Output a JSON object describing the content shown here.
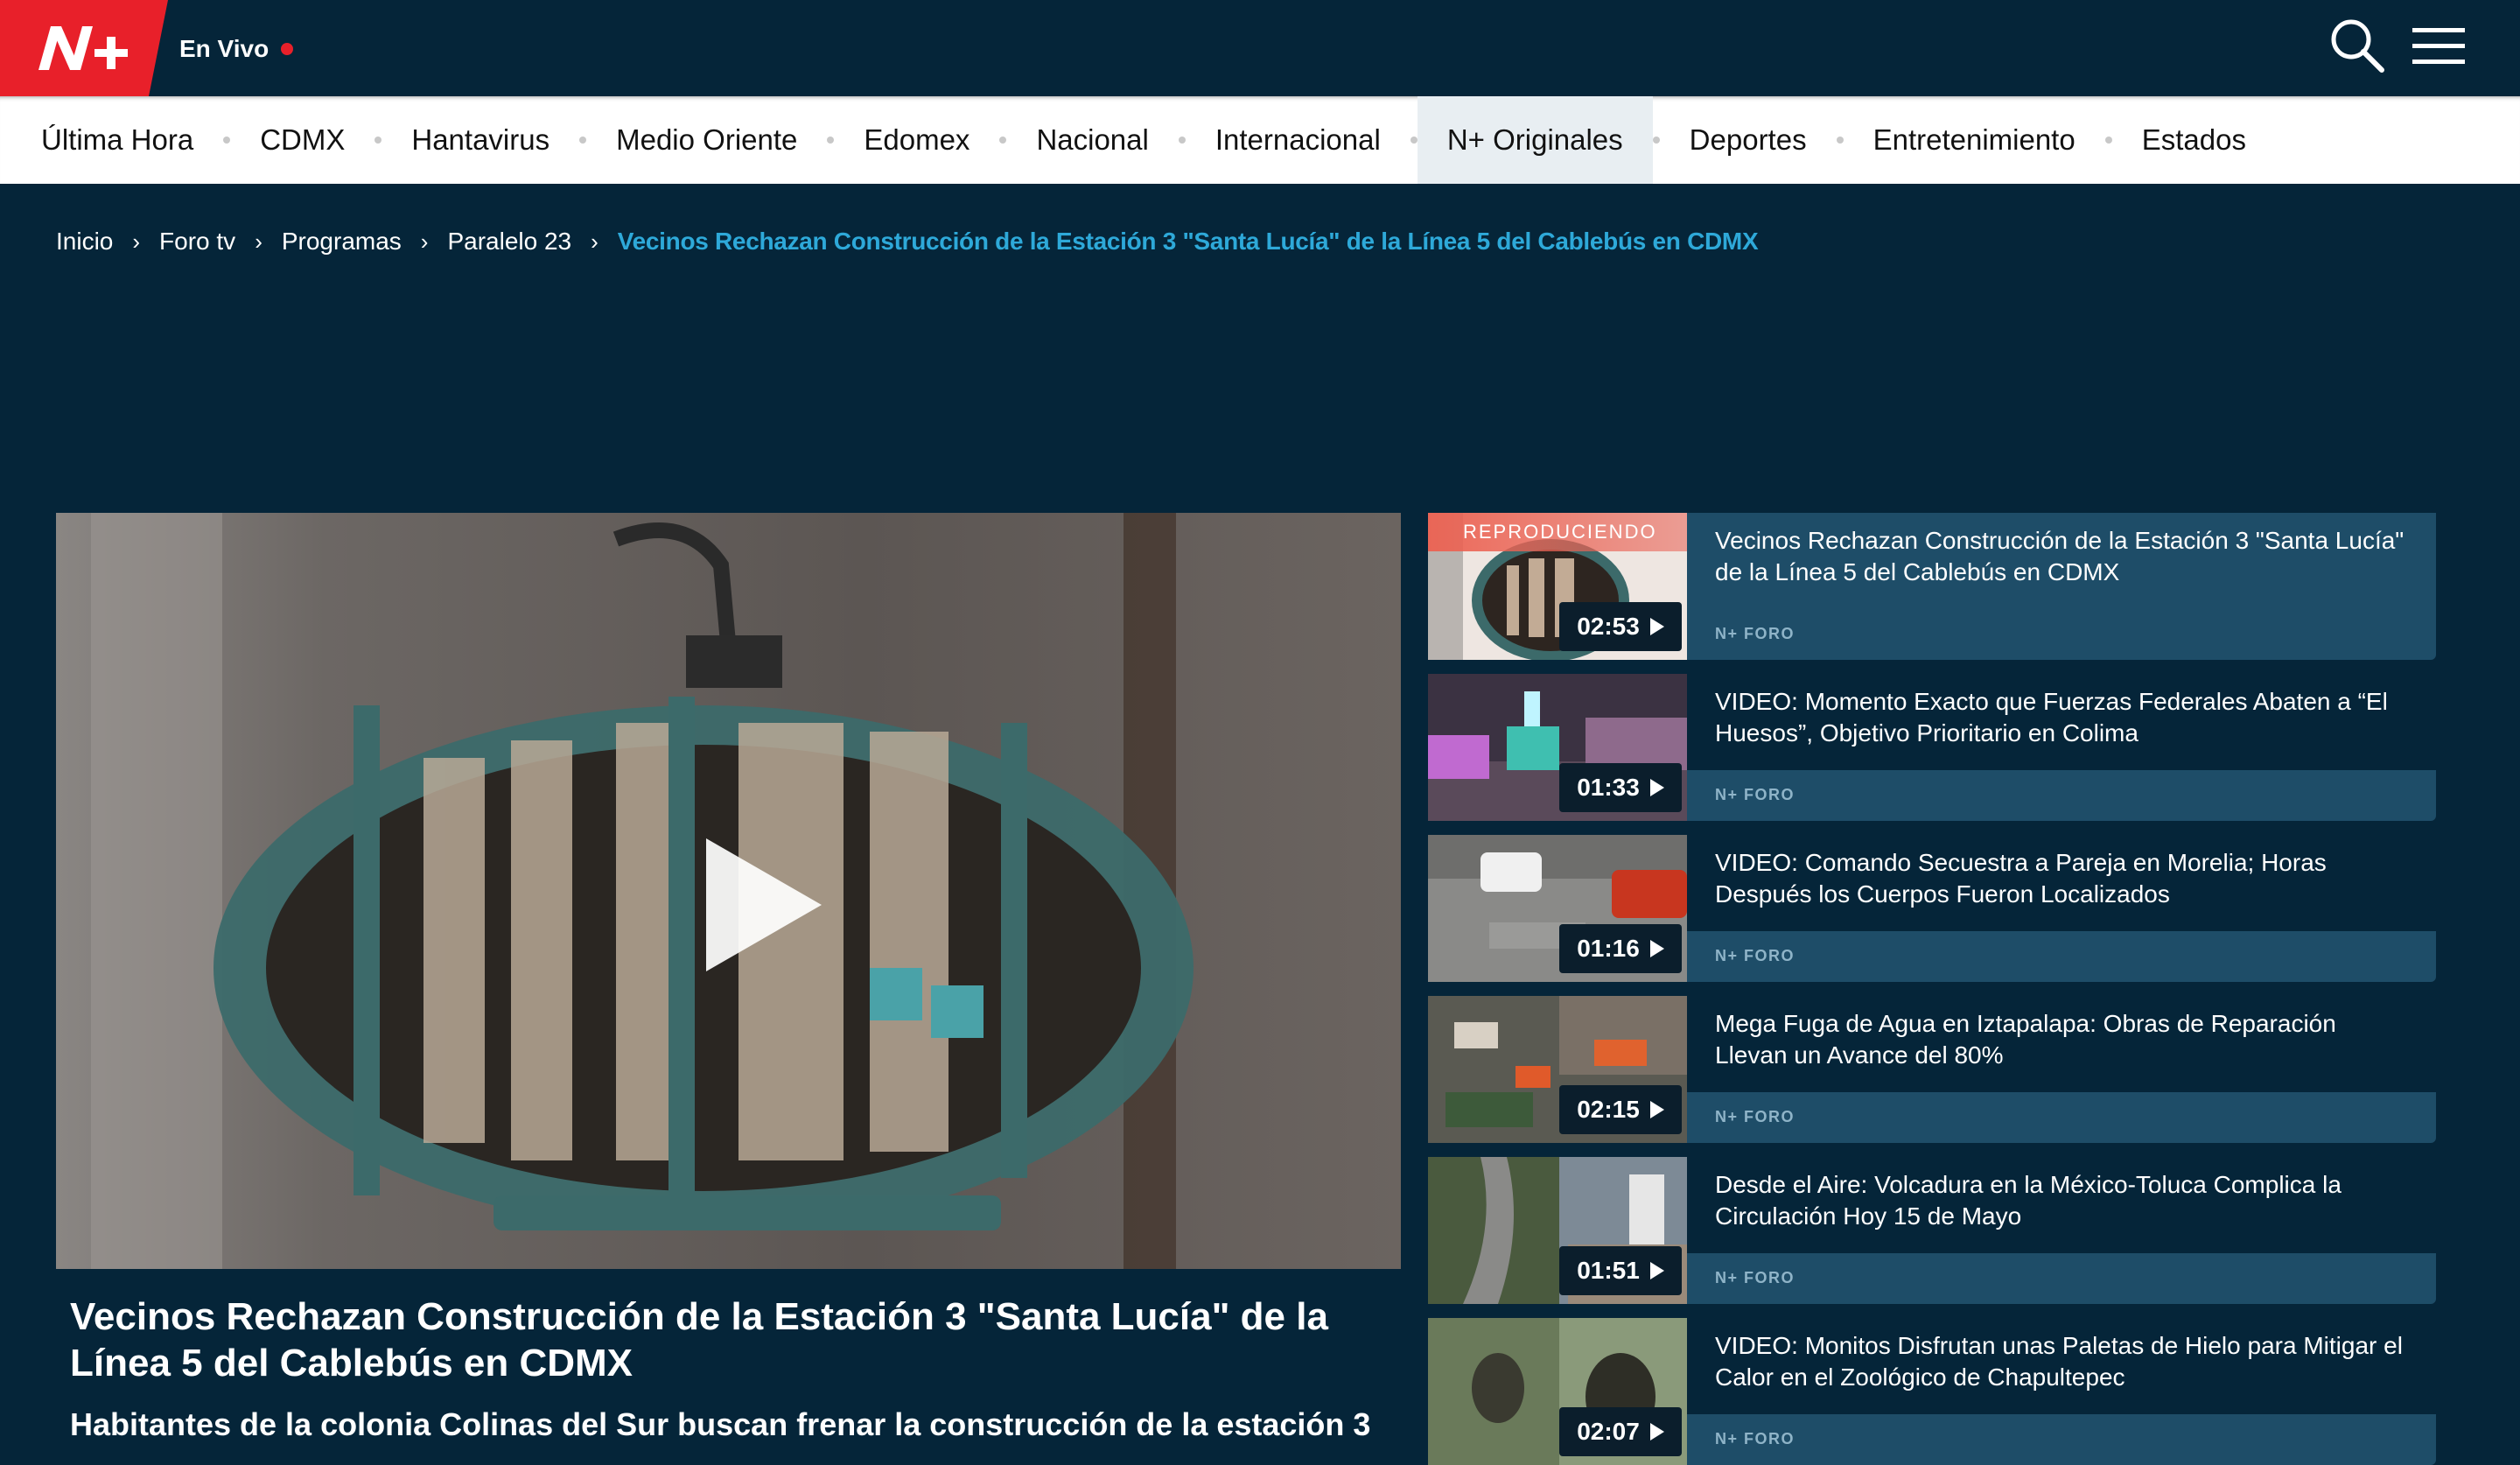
{
  "header": {
    "brand_logo": "nmas-logo",
    "live_label": "En Vivo",
    "live_dot_color": "#e8202a",
    "search_icon": "search-icon",
    "menu_icon": "hamburger-menu-icon"
  },
  "nav": {
    "items": [
      {
        "label": "Última Hora"
      },
      {
        "label": "CDMX"
      },
      {
        "label": "Hantavirus"
      },
      {
        "label": "Medio Oriente"
      },
      {
        "label": "Edomex"
      },
      {
        "label": "Nacional"
      },
      {
        "label": "Internacional"
      },
      {
        "label": "N+ Originales"
      },
      {
        "label": "Deportes"
      },
      {
        "label": "Entretenimiento"
      },
      {
        "label": "Estados"
      }
    ],
    "active": "N+ Originales"
  },
  "breadcrumb": {
    "items": [
      "Inicio",
      "Foro tv",
      "Programas",
      "Paralelo 23"
    ],
    "current": "Vecinos Rechazan Construcción de la Estación 3 \"Santa Lucía\" de la Línea 5 del Cablebús en CDMX"
  },
  "player": {
    "play_icon": "play-icon"
  },
  "article": {
    "title": "Vecinos Rechazan Construcción de la Estación 3 \"Santa Lucía\" de la Línea 5 del Cablebús en CDMX",
    "subtitle": "Habitantes de la colonia Colinas del Sur buscan frenar la construcción de la estación 3"
  },
  "playlist": {
    "now_playing_label": "REPRODUCIENDO",
    "items": [
      {
        "title": "Vecinos Rechazan Construcción de la Estación 3 \"Santa Lucía\" de la Línea 5 del Cablebús en CDMX",
        "duration": "02:53",
        "channel": "N+ FORO"
      },
      {
        "title": "VIDEO: Momento Exacto que Fuerzas Federales Abaten a “El Huesos”, Objetivo Prioritario en Colima",
        "duration": "01:33",
        "channel": "N+ FORO"
      },
      {
        "title": "VIDEO: Comando Secuestra a Pareja en Morelia; Horas Después los Cuerpos Fueron Localizados",
        "duration": "01:16",
        "channel": "N+ FORO"
      },
      {
        "title": "Mega Fuga de Agua en Iztapalapa: Obras de Reparación Llevan un Avance del 80%",
        "duration": "02:15",
        "channel": "N+ FORO"
      },
      {
        "title": "Desde el Aire: Volcadura en la México-Toluca Complica la Circulación Hoy 15 de Mayo",
        "duration": "01:51",
        "channel": "N+ FORO"
      },
      {
        "title": "VIDEO: Monitos Disfrutan unas Paletas de Hielo para Mitigar el Calor en el Zoológico de Chapultepec",
        "duration": "02:07",
        "channel": "N+ FORO"
      }
    ]
  }
}
